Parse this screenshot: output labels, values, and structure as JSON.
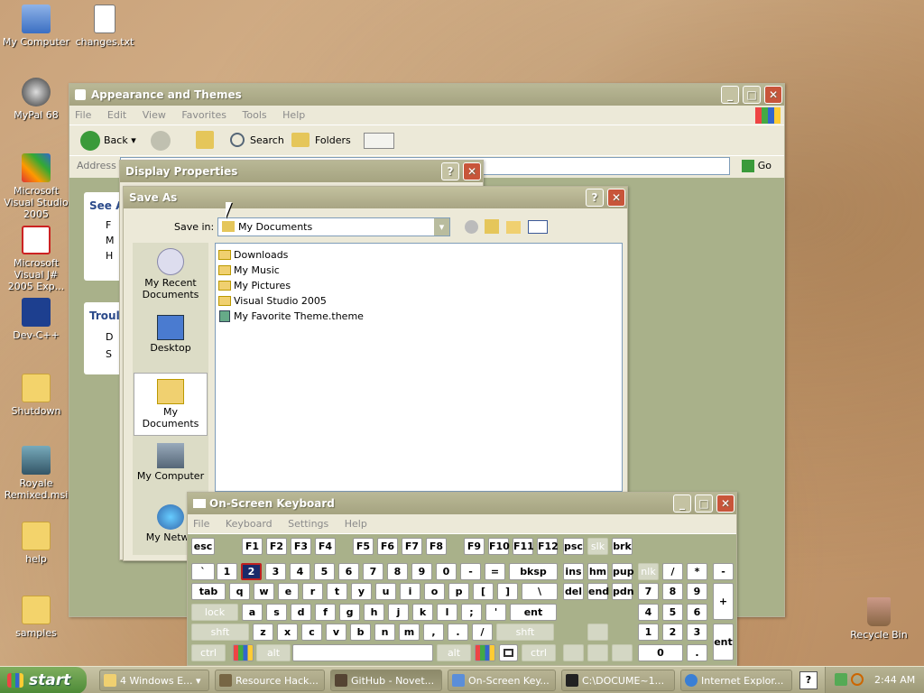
{
  "desktop_icons": [
    {
      "label": "My Computer"
    },
    {
      "label": "changes.txt"
    },
    {
      "label": "MyPal 68"
    },
    {
      "label": "Microsoft Visual Studio 2005"
    },
    {
      "label": "Microsoft Visual J# 2005 Exp..."
    },
    {
      "label": "Dev-C++"
    },
    {
      "label": "Shutdown"
    },
    {
      "label": "Royale Remixed.msi"
    },
    {
      "label": "help"
    },
    {
      "label": "samples"
    },
    {
      "label": "Recycle Bin"
    }
  ],
  "explorer": {
    "title": "Appearance and Themes",
    "menu": [
      "File",
      "Edit",
      "View",
      "Favorites",
      "Tools",
      "Help"
    ],
    "toolbar": {
      "back": "Back",
      "search": "Search",
      "folders": "Folders"
    },
    "address_label": "Address",
    "go_label": "Go",
    "see_also": "See A",
    "troubleshoot": "Troul",
    "link_letters": [
      "F",
      "M",
      "H"
    ],
    "help_letters": [
      "D",
      "S"
    ]
  },
  "display_properties": {
    "title": "Display Properties"
  },
  "save_as": {
    "title": "Save As",
    "save_in_label": "Save in:",
    "save_in_value": "My Documents",
    "places": [
      "My Recent Documents",
      "Desktop",
      "My Documents",
      "My Computer",
      "My Netwo"
    ],
    "files": [
      {
        "name": "Downloads",
        "type": "folder"
      },
      {
        "name": "My Music",
        "type": "folder"
      },
      {
        "name": "My Pictures",
        "type": "folder"
      },
      {
        "name": "Visual Studio 2005",
        "type": "folder"
      },
      {
        "name": "My Favorite Theme.theme",
        "type": "file"
      }
    ]
  },
  "osk": {
    "title": "On-Screen Keyboard",
    "menu": [
      "File",
      "Keyboard",
      "Settings",
      "Help"
    ],
    "row0": [
      "esc",
      "F1",
      "F2",
      "F3",
      "F4",
      "F5",
      "F6",
      "F7",
      "F8",
      "F9",
      "F10",
      "F11",
      "F12",
      "psc",
      "slk",
      "brk"
    ],
    "row1": [
      "`",
      "1",
      "2",
      "3",
      "4",
      "5",
      "6",
      "7",
      "8",
      "9",
      "0",
      "-",
      "=",
      "bksp",
      "ins",
      "hm",
      "pup",
      "nlk",
      "/",
      "*",
      "-"
    ],
    "row2": [
      "tab",
      "q",
      "w",
      "e",
      "r",
      "t",
      "y",
      "u",
      "i",
      "o",
      "p",
      "[",
      "]",
      "\\",
      "del",
      "end",
      "pdn",
      "7",
      "8",
      "9",
      "+"
    ],
    "row3": [
      "lock",
      "a",
      "s",
      "d",
      "f",
      "g",
      "h",
      "j",
      "k",
      "l",
      ";",
      "'",
      "ent",
      "4",
      "5",
      "6"
    ],
    "row4": [
      "shft",
      "z",
      "x",
      "c",
      "v",
      "b",
      "n",
      "m",
      ",",
      ".",
      "/",
      "shft",
      "1",
      "2",
      "3",
      "ent"
    ],
    "row5": [
      "ctrl",
      "alt",
      "alt",
      "ctrl",
      "0",
      "."
    ],
    "selected_key": "2"
  },
  "taskbar": {
    "start": "start",
    "items": [
      {
        "label": "4 Windows E..."
      },
      {
        "label": "Resource Hack..."
      },
      {
        "label": "GitHub - Novet..."
      },
      {
        "label": "On-Screen Key..."
      },
      {
        "label": "C:\\DOCUME~1..."
      },
      {
        "label": "Internet Explor..."
      }
    ],
    "clock": "2:44 AM"
  }
}
